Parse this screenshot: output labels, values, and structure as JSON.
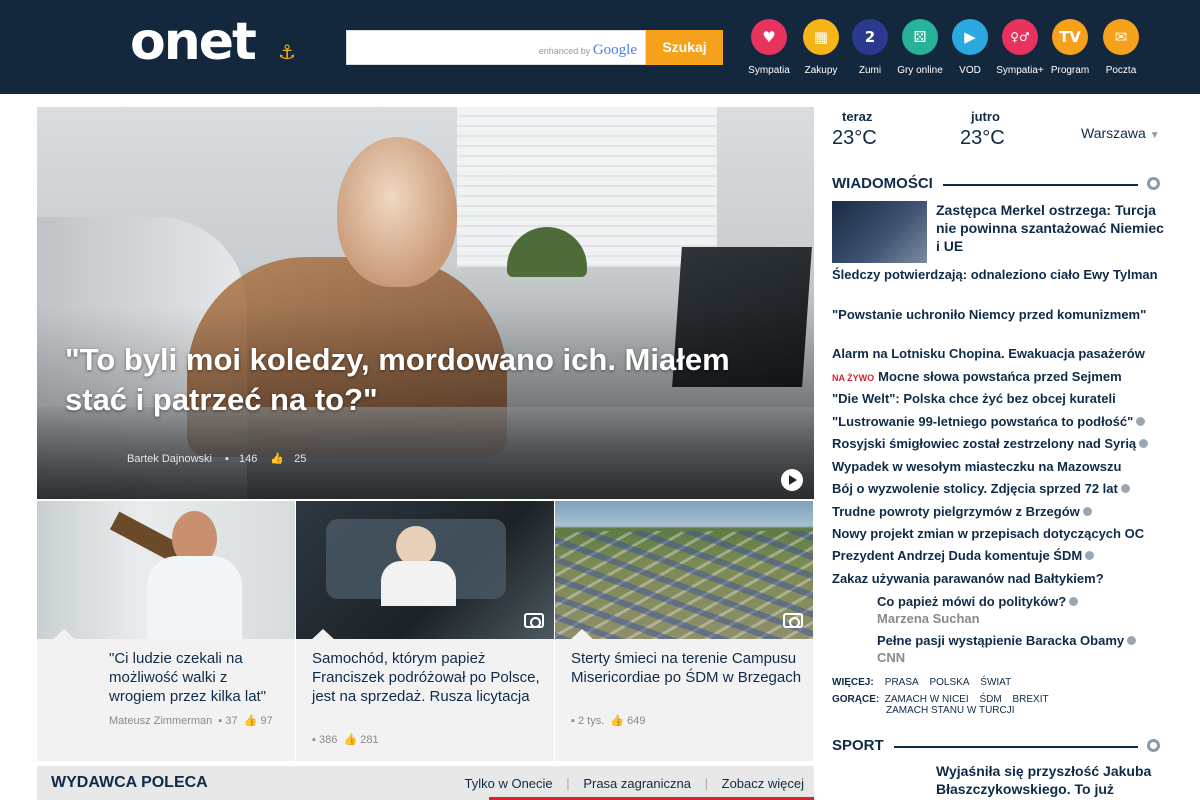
{
  "header": {
    "logo": "onet",
    "search_placeholder": "",
    "search_enhanced": "enhanced by",
    "search_google": "Google",
    "search_button": "Szukaj",
    "services": [
      {
        "label": "Sympatia",
        "icon": "heart-icon",
        "glyph": "♥",
        "color": "#e8335e"
      },
      {
        "label": "Zakupy",
        "icon": "basket-icon",
        "glyph": "▦",
        "color": "#f5b417"
      },
      {
        "label": "Zumi",
        "icon": "zumi-icon",
        "glyph": "2",
        "color": "#2b3a8f"
      },
      {
        "label": "Gry online",
        "icon": "dice-icon",
        "glyph": "⚄",
        "color": "#26b39a"
      },
      {
        "label": "VOD",
        "icon": "play-icon",
        "glyph": "▶",
        "color": "#2aa9e0"
      },
      {
        "label": "Sympatia+",
        "icon": "couple-icon",
        "glyph": "♀♂",
        "color": "#e8335e"
      },
      {
        "label": "Program",
        "icon": "tv-icon",
        "glyph": "TV",
        "color": "#f5a11c"
      },
      {
        "label": "Poczta",
        "icon": "mail-icon",
        "glyph": "✉",
        "color": "#f5a11c"
      }
    ]
  },
  "hero": {
    "title": "\"To byli moi koledzy, mordowano ich. Miałem stać i patrzeć na to?\"",
    "author": "Bartek Dajnowski",
    "comments": "146",
    "likes": "25"
  },
  "cards": [
    {
      "title": "\"Ci ludzie czekali na możliwość walki z wrogiem przez kilka lat\"",
      "author": "Mateusz Zimmerman",
      "comments": "37",
      "likes": "97"
    },
    {
      "title": "Samochód, którym papież Franciszek podróżował po Polsce, jest na sprzedaż. Rusza licytacja",
      "author": "",
      "comments": "386",
      "likes": "281"
    },
    {
      "title": "Sterty śmieci na terenie Campusu Misericordiae po ŚDM w Brzegach",
      "author": "",
      "comments": "2 tys.",
      "likes": "649"
    }
  ],
  "publisher": {
    "title": "WYDAWCA POLECA",
    "tabs": [
      "Tylko w Onecie",
      "Prasa zagraniczna",
      "Zobacz więcej"
    ]
  },
  "weather": {
    "now_label": "teraz",
    "now_temp": "23°C",
    "tomorrow_label": "jutro",
    "tomorrow_temp": "23°C",
    "city": "Warszawa"
  },
  "news": {
    "title": "WIADOMOŚCI",
    "lead": "Zastępca Merkel ostrzega: Turcja nie powinna szantażować Niemiec i UE",
    "items": [
      {
        "text": "Śledczy potwierdzają: odnaleziono ciało Ewy Tylman"
      },
      {
        "text": "\"Powstanie uchroniło Niemcy przed komunizmem\""
      },
      {
        "text": "Alarm na Lotnisku Chopina. Ewakuacja pasażerów"
      },
      {
        "text": "Mocne słowa powstańca przed Sejmem",
        "live": "NA ŻYWO"
      },
      {
        "text": "\"Die Welt\": Polska chce żyć bez obcej kurateli"
      },
      {
        "text": "\"Lustrowanie 99-letniego powstańca to podłość\"",
        "marker": true
      },
      {
        "text": "Rosyjski śmigłowiec został zestrzelony nad Syrią",
        "marker": true
      },
      {
        "text": "Wypadek w wesołym miasteczku na Mazowszu"
      },
      {
        "text": "Bój o wyzwolenie stolicy. Zdjęcia sprzed 72 lat",
        "marker": true
      },
      {
        "text": "Trudne powroty pielgrzymów z Brzegów",
        "marker": true
      },
      {
        "text": "Nowy projekt zmian w przepisach dotyczących OC"
      },
      {
        "text": "Prezydent Andrzej Duda komentuje ŚDM",
        "marker": true
      },
      {
        "text": "Zakaz używania parawanów nad Bałtykiem?"
      }
    ],
    "sub": [
      {
        "text": "Co papież mówi do polityków?",
        "source": "Marzena Suchan"
      },
      {
        "text": "Pełne pasji wystąpienie Baracka Obamy",
        "source": "CNN"
      }
    ],
    "more_label": "WIĘCEJ:",
    "more": [
      "Prasa",
      "Polska",
      "Świat"
    ],
    "hot_label": "GORĄCE:",
    "hot": [
      "Zamach w Nicei",
      "ŚDM",
      "Brexit"
    ],
    "hot2": [
      "Zamach stanu w Turcji"
    ]
  },
  "sport": {
    "title": "SPORT",
    "lead": "Wyjaśniła się przyszłość Jakuba Błaszczykowskiego. To już"
  }
}
